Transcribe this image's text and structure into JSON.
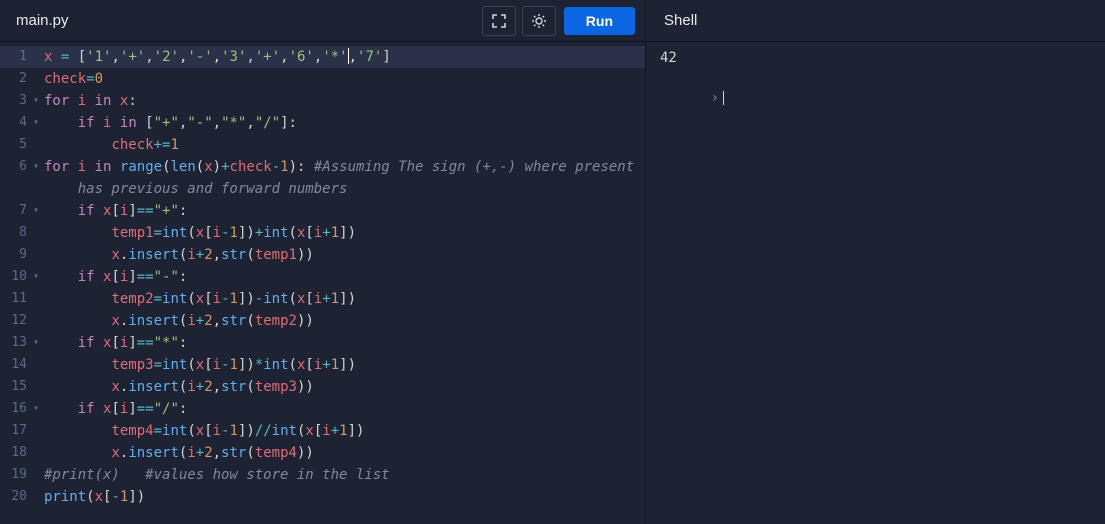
{
  "tabs": {
    "main": "main.py"
  },
  "buttons": {
    "run": "Run"
  },
  "shell": {
    "title": "Shell",
    "output": "42",
    "prompt": ""
  },
  "code": {
    "lines": [
      {
        "n": 1,
        "fold": "",
        "tokens": [
          [
            "var",
            "x"
          ],
          [
            "pun",
            " "
          ],
          [
            "op",
            "="
          ],
          [
            "pun",
            " ["
          ],
          [
            "str",
            "'1'"
          ],
          [
            "pun",
            ","
          ],
          [
            "str",
            "'+'"
          ],
          [
            "pun",
            ","
          ],
          [
            "str",
            "'2'"
          ],
          [
            "pun",
            ","
          ],
          [
            "str",
            "'-'"
          ],
          [
            "pun",
            ","
          ],
          [
            "str",
            "'3'"
          ],
          [
            "pun",
            ","
          ],
          [
            "str",
            "'+'"
          ],
          [
            "pun",
            ","
          ],
          [
            "str",
            "'6'"
          ],
          [
            "pun",
            ","
          ],
          [
            "str",
            "'*'"
          ],
          [
            "pun",
            ","
          ],
          [
            "str",
            "'7'"
          ],
          [
            "pun",
            "]"
          ]
        ],
        "active": true,
        "cursorAfter": 19
      },
      {
        "n": 2,
        "fold": "",
        "tokens": [
          [
            "var",
            "check"
          ],
          [
            "op",
            "="
          ],
          [
            "num",
            "0"
          ]
        ]
      },
      {
        "n": 3,
        "fold": "▾",
        "tokens": [
          [
            "kw",
            "for"
          ],
          [
            "pun",
            " "
          ],
          [
            "var",
            "i"
          ],
          [
            "pun",
            " "
          ],
          [
            "kw",
            "in"
          ],
          [
            "pun",
            " "
          ],
          [
            "var",
            "x"
          ],
          [
            "pun",
            ":"
          ]
        ]
      },
      {
        "n": 4,
        "fold": "▾",
        "indent": 1,
        "tokens": [
          [
            "kw",
            "if"
          ],
          [
            "pun",
            " "
          ],
          [
            "var",
            "i"
          ],
          [
            "pun",
            " "
          ],
          [
            "kw",
            "in"
          ],
          [
            "pun",
            " ["
          ],
          [
            "str",
            "\"+\""
          ],
          [
            "pun",
            ","
          ],
          [
            "str",
            "\"-\""
          ],
          [
            "pun",
            ","
          ],
          [
            "str",
            "\"*\""
          ],
          [
            "pun",
            ","
          ],
          [
            "str",
            "\"/\""
          ],
          [
            "pun",
            "]:"
          ]
        ]
      },
      {
        "n": 5,
        "fold": "",
        "indent": 2,
        "tokens": [
          [
            "var",
            "check"
          ],
          [
            "op",
            "+="
          ],
          [
            "num",
            "1"
          ]
        ]
      },
      {
        "n": 6,
        "fold": "▾",
        "tokens": [
          [
            "kw",
            "for"
          ],
          [
            "pun",
            " "
          ],
          [
            "var",
            "i"
          ],
          [
            "pun",
            " "
          ],
          [
            "kw",
            "in"
          ],
          [
            "pun",
            " "
          ],
          [
            "fn",
            "range"
          ],
          [
            "pun",
            "("
          ],
          [
            "fn",
            "len"
          ],
          [
            "pun",
            "("
          ],
          [
            "var",
            "x"
          ],
          [
            "pun",
            ")"
          ],
          [
            "op",
            "+"
          ],
          [
            "var",
            "check"
          ],
          [
            "op",
            "-"
          ],
          [
            "num",
            "1"
          ],
          [
            "pun",
            "): "
          ],
          [
            "cmt",
            "#Assuming The sign (+,-) where present "
          ]
        ]
      },
      {
        "n": "",
        "fold": "",
        "indent": 1,
        "tokens": [
          [
            "cmt",
            "has previous and forward numbers"
          ]
        ]
      },
      {
        "n": 7,
        "fold": "▾",
        "indent": 1,
        "tokens": [
          [
            "kw",
            "if"
          ],
          [
            "pun",
            " "
          ],
          [
            "var",
            "x"
          ],
          [
            "pun",
            "["
          ],
          [
            "var",
            "i"
          ],
          [
            "pun",
            "]"
          ],
          [
            "op",
            "=="
          ],
          [
            "str",
            "\"+\""
          ],
          [
            "pun",
            ":"
          ]
        ]
      },
      {
        "n": 8,
        "fold": "",
        "indent": 2,
        "tokens": [
          [
            "var",
            "temp1"
          ],
          [
            "op",
            "="
          ],
          [
            "fn",
            "int"
          ],
          [
            "pun",
            "("
          ],
          [
            "var",
            "x"
          ],
          [
            "pun",
            "["
          ],
          [
            "var",
            "i"
          ],
          [
            "op",
            "-"
          ],
          [
            "num",
            "1"
          ],
          [
            "pun",
            "])"
          ],
          [
            "op",
            "+"
          ],
          [
            "fn",
            "int"
          ],
          [
            "pun",
            "("
          ],
          [
            "var",
            "x"
          ],
          [
            "pun",
            "["
          ],
          [
            "var",
            "i"
          ],
          [
            "op",
            "+"
          ],
          [
            "num",
            "1"
          ],
          [
            "pun",
            "])"
          ]
        ]
      },
      {
        "n": 9,
        "fold": "",
        "indent": 2,
        "tokens": [
          [
            "var",
            "x"
          ],
          [
            "pun",
            "."
          ],
          [
            "fn",
            "insert"
          ],
          [
            "pun",
            "("
          ],
          [
            "var",
            "i"
          ],
          [
            "op",
            "+"
          ],
          [
            "num",
            "2"
          ],
          [
            "pun",
            ","
          ],
          [
            "fn",
            "str"
          ],
          [
            "pun",
            "("
          ],
          [
            "var",
            "temp1"
          ],
          [
            "pun",
            "))"
          ]
        ]
      },
      {
        "n": 10,
        "fold": "▾",
        "indent": 1,
        "tokens": [
          [
            "kw",
            "if"
          ],
          [
            "pun",
            " "
          ],
          [
            "var",
            "x"
          ],
          [
            "pun",
            "["
          ],
          [
            "var",
            "i"
          ],
          [
            "pun",
            "]"
          ],
          [
            "op",
            "=="
          ],
          [
            "str",
            "\"-\""
          ],
          [
            "pun",
            ":"
          ]
        ]
      },
      {
        "n": 11,
        "fold": "",
        "indent": 2,
        "tokens": [
          [
            "var",
            "temp2"
          ],
          [
            "op",
            "="
          ],
          [
            "fn",
            "int"
          ],
          [
            "pun",
            "("
          ],
          [
            "var",
            "x"
          ],
          [
            "pun",
            "["
          ],
          [
            "var",
            "i"
          ],
          [
            "op",
            "-"
          ],
          [
            "num",
            "1"
          ],
          [
            "pun",
            "])"
          ],
          [
            "op",
            "-"
          ],
          [
            "fn",
            "int"
          ],
          [
            "pun",
            "("
          ],
          [
            "var",
            "x"
          ],
          [
            "pun",
            "["
          ],
          [
            "var",
            "i"
          ],
          [
            "op",
            "+"
          ],
          [
            "num",
            "1"
          ],
          [
            "pun",
            "])"
          ]
        ]
      },
      {
        "n": 12,
        "fold": "",
        "indent": 2,
        "tokens": [
          [
            "var",
            "x"
          ],
          [
            "pun",
            "."
          ],
          [
            "fn",
            "insert"
          ],
          [
            "pun",
            "("
          ],
          [
            "var",
            "i"
          ],
          [
            "op",
            "+"
          ],
          [
            "num",
            "2"
          ],
          [
            "pun",
            ","
          ],
          [
            "fn",
            "str"
          ],
          [
            "pun",
            "("
          ],
          [
            "var",
            "temp2"
          ],
          [
            "pun",
            "))"
          ]
        ]
      },
      {
        "n": 13,
        "fold": "▾",
        "indent": 1,
        "tokens": [
          [
            "kw",
            "if"
          ],
          [
            "pun",
            " "
          ],
          [
            "var",
            "x"
          ],
          [
            "pun",
            "["
          ],
          [
            "var",
            "i"
          ],
          [
            "pun",
            "]"
          ],
          [
            "op",
            "=="
          ],
          [
            "str",
            "\"*\""
          ],
          [
            "pun",
            ":"
          ]
        ]
      },
      {
        "n": 14,
        "fold": "",
        "indent": 2,
        "tokens": [
          [
            "var",
            "temp3"
          ],
          [
            "op",
            "="
          ],
          [
            "fn",
            "int"
          ],
          [
            "pun",
            "("
          ],
          [
            "var",
            "x"
          ],
          [
            "pun",
            "["
          ],
          [
            "var",
            "i"
          ],
          [
            "op",
            "-"
          ],
          [
            "num",
            "1"
          ],
          [
            "pun",
            "])"
          ],
          [
            "op",
            "*"
          ],
          [
            "fn",
            "int"
          ],
          [
            "pun",
            "("
          ],
          [
            "var",
            "x"
          ],
          [
            "pun",
            "["
          ],
          [
            "var",
            "i"
          ],
          [
            "op",
            "+"
          ],
          [
            "num",
            "1"
          ],
          [
            "pun",
            "])"
          ]
        ]
      },
      {
        "n": 15,
        "fold": "",
        "indent": 2,
        "tokens": [
          [
            "var",
            "x"
          ],
          [
            "pun",
            "."
          ],
          [
            "fn",
            "insert"
          ],
          [
            "pun",
            "("
          ],
          [
            "var",
            "i"
          ],
          [
            "op",
            "+"
          ],
          [
            "num",
            "2"
          ],
          [
            "pun",
            ","
          ],
          [
            "fn",
            "str"
          ],
          [
            "pun",
            "("
          ],
          [
            "var",
            "temp3"
          ],
          [
            "pun",
            "))"
          ]
        ]
      },
      {
        "n": 16,
        "fold": "▾",
        "indent": 1,
        "tokens": [
          [
            "kw",
            "if"
          ],
          [
            "pun",
            " "
          ],
          [
            "var",
            "x"
          ],
          [
            "pun",
            "["
          ],
          [
            "var",
            "i"
          ],
          [
            "pun",
            "]"
          ],
          [
            "op",
            "=="
          ],
          [
            "str",
            "\"/\""
          ],
          [
            "pun",
            ":"
          ]
        ]
      },
      {
        "n": 17,
        "fold": "",
        "indent": 2,
        "tokens": [
          [
            "var",
            "temp4"
          ],
          [
            "op",
            "="
          ],
          [
            "fn",
            "int"
          ],
          [
            "pun",
            "("
          ],
          [
            "var",
            "x"
          ],
          [
            "pun",
            "["
          ],
          [
            "var",
            "i"
          ],
          [
            "op",
            "-"
          ],
          [
            "num",
            "1"
          ],
          [
            "pun",
            "])"
          ],
          [
            "op",
            "//"
          ],
          [
            "fn",
            "int"
          ],
          [
            "pun",
            "("
          ],
          [
            "var",
            "x"
          ],
          [
            "pun",
            "["
          ],
          [
            "var",
            "i"
          ],
          [
            "op",
            "+"
          ],
          [
            "num",
            "1"
          ],
          [
            "pun",
            "])"
          ]
        ]
      },
      {
        "n": 18,
        "fold": "",
        "indent": 2,
        "tokens": [
          [
            "var",
            "x"
          ],
          [
            "pun",
            "."
          ],
          [
            "fn",
            "insert"
          ],
          [
            "pun",
            "("
          ],
          [
            "var",
            "i"
          ],
          [
            "op",
            "+"
          ],
          [
            "num",
            "2"
          ],
          [
            "pun",
            ","
          ],
          [
            "fn",
            "str"
          ],
          [
            "pun",
            "("
          ],
          [
            "var",
            "temp4"
          ],
          [
            "pun",
            "))"
          ]
        ]
      },
      {
        "n": 19,
        "fold": "",
        "tokens": [
          [
            "cmt",
            "#print(x)   #values how store in the list"
          ]
        ]
      },
      {
        "n": 20,
        "fold": "",
        "tokens": [
          [
            "fn",
            "print"
          ],
          [
            "pun",
            "("
          ],
          [
            "var",
            "x"
          ],
          [
            "pun",
            "["
          ],
          [
            "op",
            "-"
          ],
          [
            "num",
            "1"
          ],
          [
            "pun",
            "])"
          ]
        ]
      }
    ]
  }
}
